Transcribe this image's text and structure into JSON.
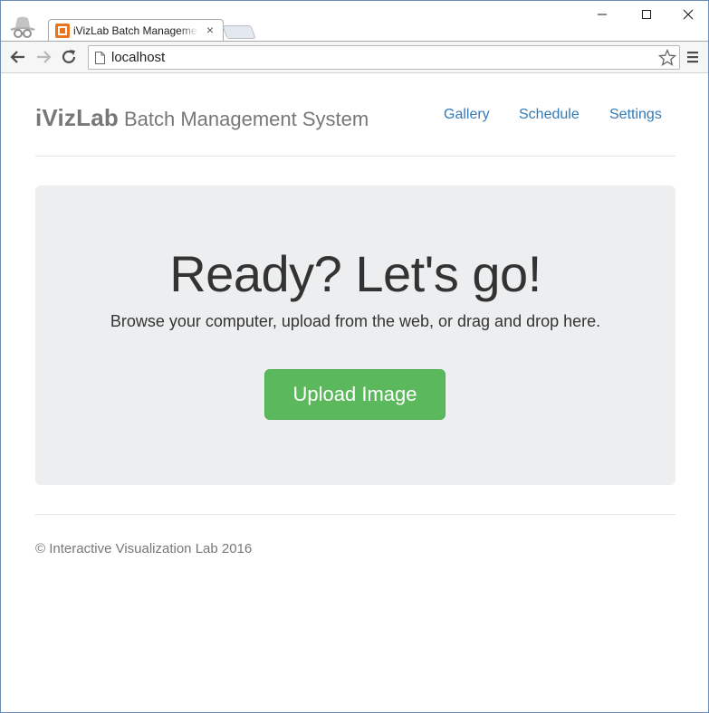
{
  "browser": {
    "tab_title": "iVizLab Batch Management System",
    "tab_close_label": "×",
    "url": "localhost",
    "icons": {
      "incognito": "incognito-icon",
      "favicon": "xampp-favicon",
      "back": "back-arrow-icon",
      "forward": "forward-arrow-icon",
      "reload": "reload-icon",
      "page": "page-icon",
      "star": "star-icon",
      "menu": "hamburger-menu-icon",
      "minimize": "minimize-icon",
      "maximize": "maximize-icon",
      "close": "close-icon"
    }
  },
  "header": {
    "brand_strong": "iVizLab",
    "brand_rest": "Batch Management System",
    "nav": [
      "Gallery",
      "Schedule",
      "Settings"
    ]
  },
  "hero": {
    "title": "Ready? Let's go!",
    "lead": "Browse your computer, upload from the web, or drag and drop here.",
    "button_label": "Upload Image"
  },
  "footer": {
    "text": "© Interactive Visualization Lab 2016"
  },
  "colors": {
    "link": "#337ab7",
    "success": "#5cb85c",
    "jumbotron_bg": "#eceeef",
    "muted_text": "#777777",
    "favicon": "#e8741d"
  }
}
